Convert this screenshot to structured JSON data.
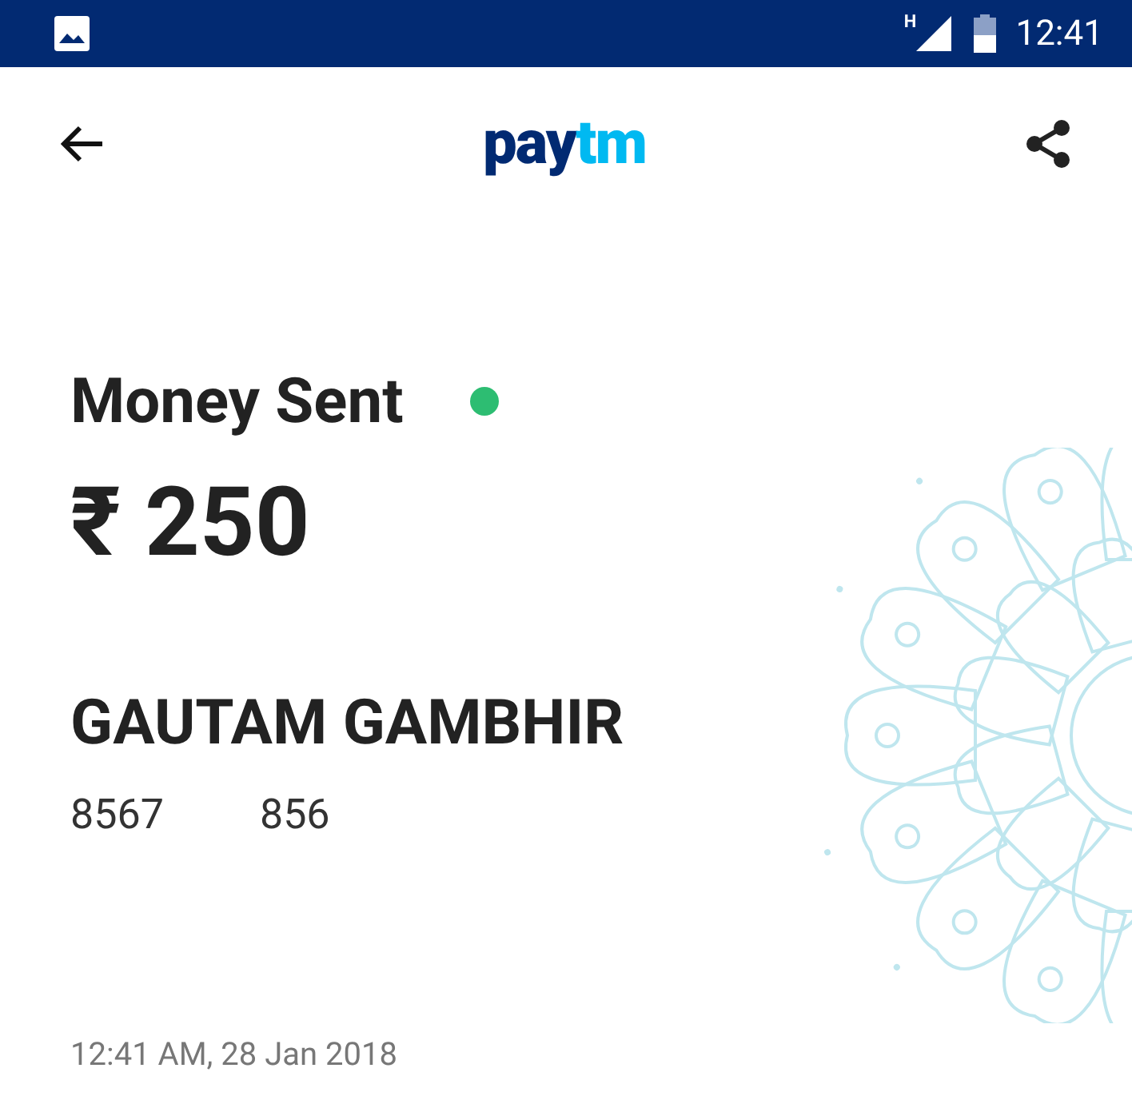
{
  "status_bar": {
    "network_label": "H",
    "time": "12:41"
  },
  "toolbar": {
    "logo": {
      "part_1": "pay",
      "part_2": "tm"
    }
  },
  "transaction": {
    "status": "Money Sent",
    "status_dot": {
      "color": "#2dbd72"
    },
    "amount": "₹ 250",
    "recipient": "GAUTAM GAMBHIR",
    "phone_parts": [
      "8567",
      "856"
    ],
    "timestamp": "12:41 AM, 28 Jan 2018"
  }
}
